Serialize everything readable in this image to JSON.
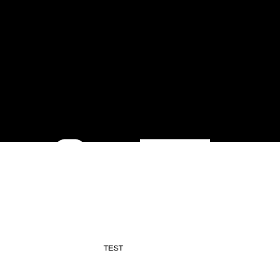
{
  "canvas": {
    "top_color": "#000000",
    "bottom_color": "#ffffff"
  },
  "caption": {
    "text": "TEST",
    "color": "#000000"
  }
}
